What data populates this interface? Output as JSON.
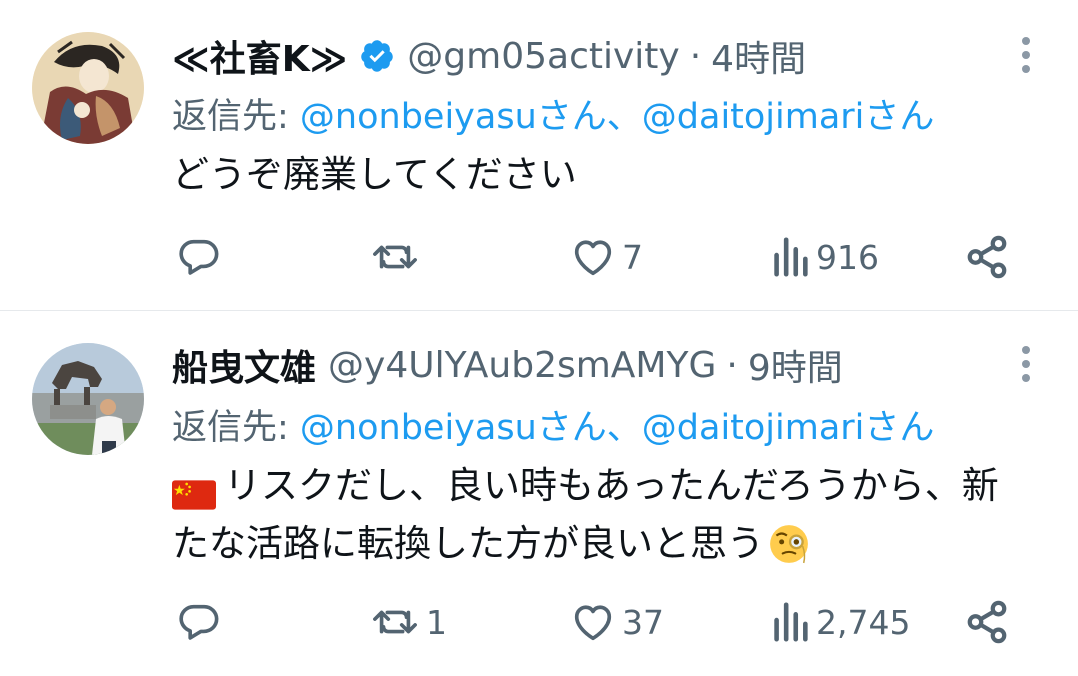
{
  "tweets": [
    {
      "display_name": "≪社畜K≫",
      "verified": true,
      "handle": "@gm05activity",
      "separator": "·",
      "time": "4時間",
      "reply_prefix": "返信先: ",
      "reply_mention_1": "@nonbeiyasuさん",
      "reply_sep": "、",
      "reply_mention_2": "@daitojimariさん",
      "body_lines": [
        "どうぞ廃業してください"
      ],
      "actions": {
        "reply": "",
        "retweet": "",
        "like": "7",
        "views": "916"
      }
    },
    {
      "display_name": "船曳文雄",
      "verified": false,
      "handle": "@y4UlYAub2smAMYG",
      "separator": "·",
      "time": "9時間",
      "reply_prefix": "返信先: ",
      "reply_mention_1": "@nonbeiyasuさん",
      "reply_sep": "、",
      "reply_mention_2": "@daitojimariさん",
      "body_lines": [
        "リスクだし、良い時もあったんだろうから、新",
        "たな活路に転換した方が良いと思う"
      ],
      "actions": {
        "reply": "",
        "retweet": "1",
        "like": "37",
        "views": "2,745"
      }
    }
  ],
  "icons": {
    "verified": "verified-badge-icon",
    "more": "more-vertical-icon",
    "reply": "reply-bubble-icon",
    "retweet": "retweet-arrows-icon",
    "like": "heart-icon",
    "views": "bar-chart-icon",
    "share": "share-icon",
    "flag": "china-flag-emoji",
    "monocle": "monocle-face-emoji"
  },
  "colors": {
    "text": "#0f1419",
    "secondary": "#536471",
    "link": "#1d9bf0",
    "verified": "#1d9bf0",
    "divider": "#e6e9ec"
  }
}
